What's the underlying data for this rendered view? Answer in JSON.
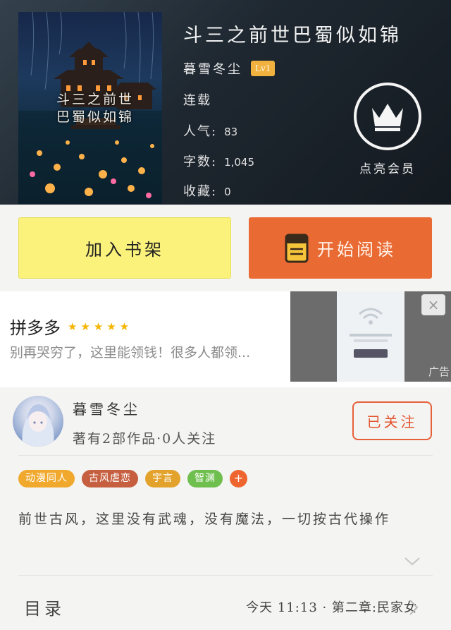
{
  "book": {
    "title": "斗三之前世巴蜀似如锦",
    "cover_title_lines": [
      "斗三之前世",
      "巴蜀似如锦"
    ],
    "author": "暮雪冬尘",
    "author_level": "Lv1",
    "status": "连载",
    "popularity_label": "人气:",
    "popularity_value": "83",
    "word_count_label": "字数:",
    "word_count_value": "1,045",
    "favorites_label": "收藏:",
    "favorites_value": "0"
  },
  "vip": {
    "label": "点亮会员",
    "icon": "crown-icon"
  },
  "actions": {
    "add_to_shelf": "加入书架",
    "start_reading": "开始阅读",
    "read_icon": "book-icon"
  },
  "ad": {
    "brand": "拼多多",
    "stars": "★★★★★",
    "description": "别再哭穷了，这里能领钱！很多人都领...",
    "close_icon": "×",
    "ad_mark": "广告"
  },
  "author_card": {
    "name": "暮雪冬尘",
    "stats": "著有2部作品·0人关注",
    "follow_label": "已关注"
  },
  "tags": [
    {
      "label": "动漫同人",
      "color": "#f0a82d"
    },
    {
      "label": "古风虐恋",
      "color": "#c55f3f"
    },
    {
      "label": "宇言",
      "color": "#e2a22c"
    },
    {
      "label": "智渊",
      "color": "#6fbf4f"
    }
  ],
  "tag_more": {
    "label": "+",
    "color": "#ef6530"
  },
  "synopsis": "前世古风，这里没有武魂，没有魔法，一切按古代操作",
  "toc": {
    "label": "目录",
    "latest": "今天 11:13 · 第二章:民家女"
  },
  "colors": {
    "accent_orange": "#ea6a34",
    "shelf_yellow": "#fbf27c",
    "badge_gold": "#f0b13e",
    "follow_red": "#e2542e"
  }
}
